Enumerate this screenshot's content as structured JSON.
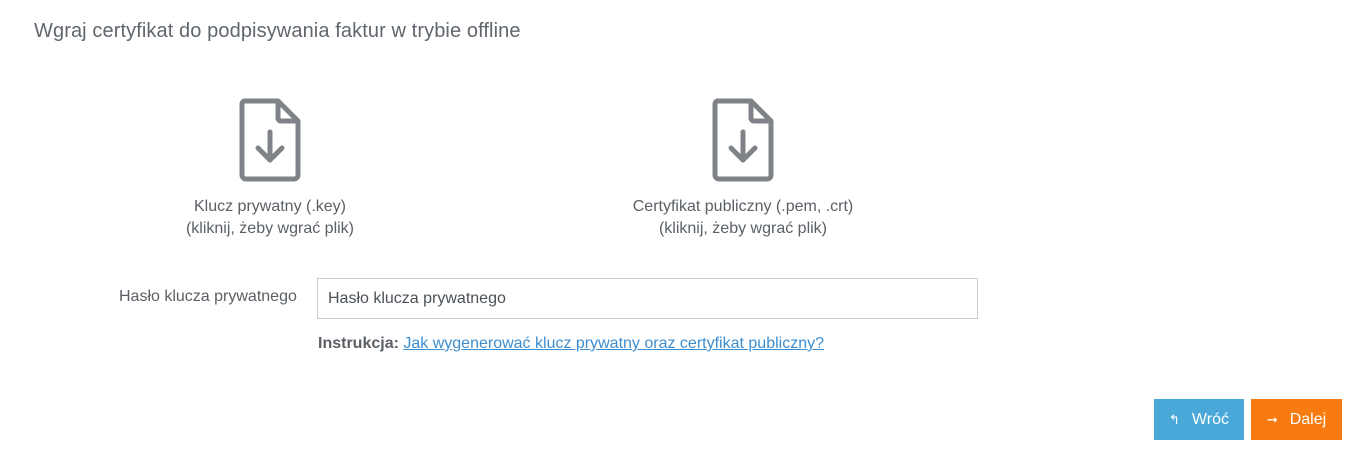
{
  "page": {
    "title": "Wgraj certyfikat do podpisywania faktur w trybie offline"
  },
  "uploads": {
    "private_key": {
      "icon": "file-download-icon",
      "line1": "Klucz prywatny (.key)",
      "line2": "(kliknij, żeby wgrać plik)"
    },
    "public_cert": {
      "icon": "file-download-icon",
      "line1": "Certyfikat publiczny (.pem, .crt)",
      "line2": "(kliknij, żeby wgrać plik)"
    }
  },
  "password": {
    "label": "Hasło klucza prywatnego",
    "placeholder": "Hasło klucza prywatnego",
    "value": ""
  },
  "instruction": {
    "prefix": "Instrukcja:",
    "link_text": "Jak wygenerować klucz prywatny oraz certyfikat publiczny?"
  },
  "buttons": {
    "back": {
      "label": "Wróć",
      "icon": "undo-arrow-icon",
      "color": "#4aa8d8"
    },
    "next": {
      "label": "Dalej",
      "icon": "arrow-right-icon",
      "color": "#f77b10"
    }
  }
}
